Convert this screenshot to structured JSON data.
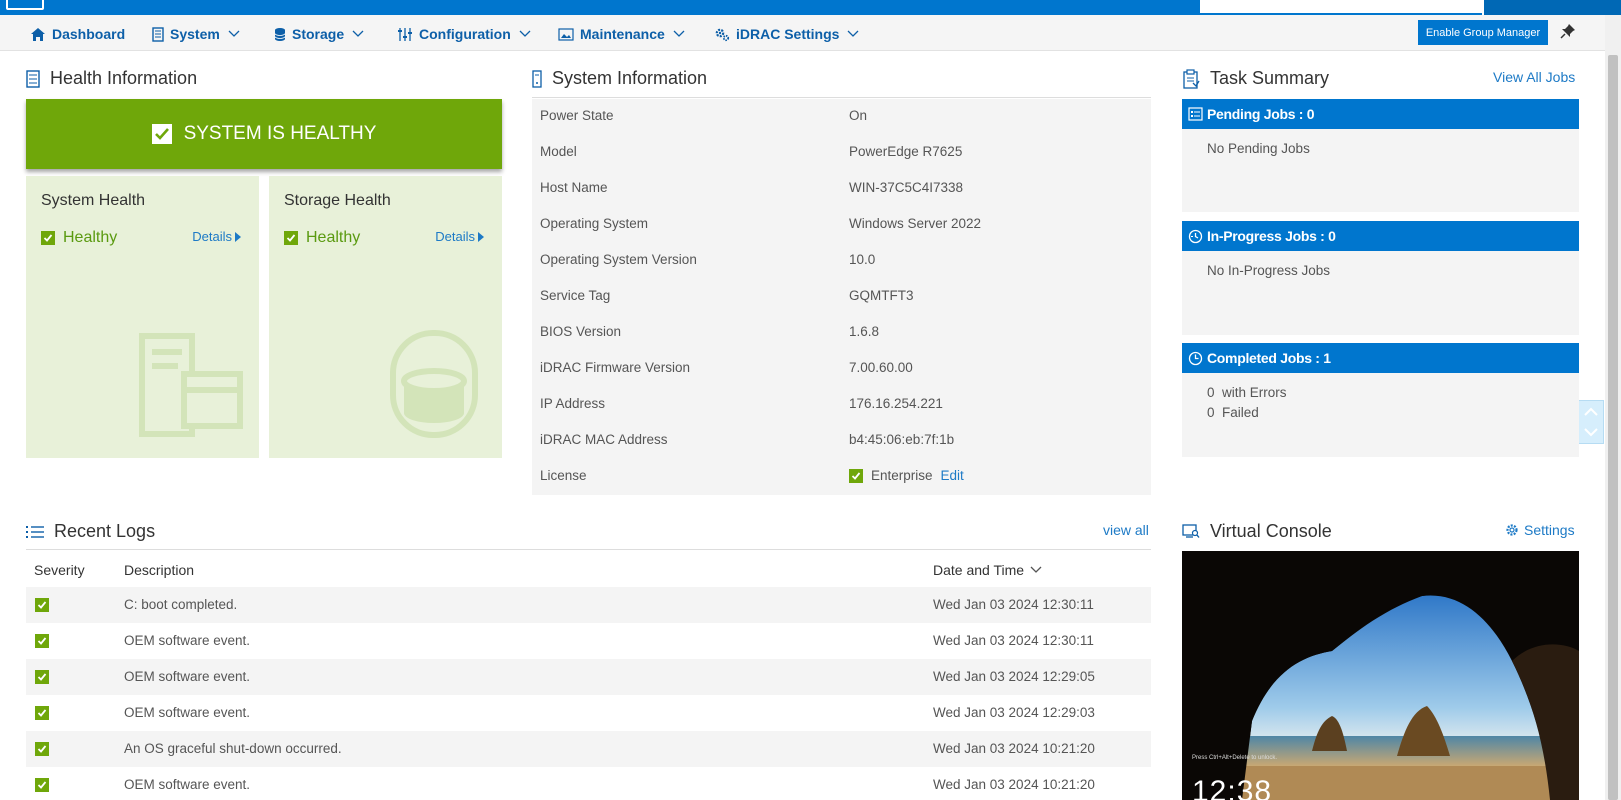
{
  "nav": {
    "items": [
      {
        "label": "Dashboard",
        "icon": "home-icon"
      },
      {
        "label": "System",
        "icon": "server-icon"
      },
      {
        "label": "Storage",
        "icon": "database-icon"
      },
      {
        "label": "Configuration",
        "icon": "sliders-icon"
      },
      {
        "label": "Maintenance",
        "icon": "image-icon"
      },
      {
        "label": "iDRAC Settings",
        "icon": "gears-icon"
      }
    ],
    "group_manager_label": "Enable Group Manager"
  },
  "health": {
    "title": "Health Information",
    "banner": "SYSTEM IS HEALTHY",
    "cards": [
      {
        "title": "System Health",
        "status": "Healthy",
        "details": "Details"
      },
      {
        "title": "Storage Health",
        "status": "Healthy",
        "details": "Details"
      }
    ]
  },
  "system_info": {
    "title": "System Information",
    "rows": [
      {
        "key": "Power State",
        "value": "On"
      },
      {
        "key": "Model",
        "value": "PowerEdge R7625"
      },
      {
        "key": "Host Name",
        "value": "WIN-37C5C4I7338"
      },
      {
        "key": "Operating System",
        "value": "Windows Server 2022"
      },
      {
        "key": "Operating System Version",
        "value": "10.0"
      },
      {
        "key": "Service Tag",
        "value": "GQMTFT3"
      },
      {
        "key": "BIOS Version",
        "value": "1.6.8"
      },
      {
        "key": "iDRAC Firmware Version",
        "value": "7.00.60.00"
      },
      {
        "key": "IP Address",
        "value": "176.16.254.221"
      },
      {
        "key": "iDRAC MAC Address",
        "value": "b4:45:06:eb:7f:1b"
      }
    ],
    "license": {
      "key": "License",
      "value": "Enterprise",
      "edit": "Edit"
    }
  },
  "tasks": {
    "title": "Task Summary",
    "view_all": "View All Jobs",
    "pending": {
      "head": "Pending Jobs : 0",
      "body": "No Pending Jobs"
    },
    "in_progress": {
      "head": "In-Progress Jobs : 0",
      "body": "No In-Progress Jobs"
    },
    "completed": {
      "head": "Completed Jobs : 1",
      "errors_count": "0",
      "errors_label": "with Errors",
      "failed_count": "0",
      "failed_label": "Failed"
    }
  },
  "logs": {
    "title": "Recent Logs",
    "view_all": "view all",
    "columns": {
      "severity": "Severity",
      "description": "Description",
      "datetime": "Date and Time"
    },
    "rows": [
      {
        "description": "C: boot completed.",
        "datetime": "Wed Jan 03 2024 12:30:11"
      },
      {
        "description": "OEM software event.",
        "datetime": "Wed Jan 03 2024 12:30:11"
      },
      {
        "description": "OEM software event.",
        "datetime": "Wed Jan 03 2024 12:29:05"
      },
      {
        "description": "OEM software event.",
        "datetime": "Wed Jan 03 2024 12:29:03"
      },
      {
        "description": "An OS graceful shut-down occurred.",
        "datetime": "Wed Jan 03 2024 10:21:20"
      },
      {
        "description": "OEM software event.",
        "datetime": "Wed Jan 03 2024 10:21:20"
      }
    ]
  },
  "console": {
    "title": "Virtual Console",
    "settings": "Settings",
    "hint": "Press Ctrl+Alt+Delete to unlock.",
    "clock": "12:38"
  },
  "colors": {
    "accent": "#0076ce",
    "healthy": "#6fa70a",
    "card_bg": "#e8f1d9"
  }
}
